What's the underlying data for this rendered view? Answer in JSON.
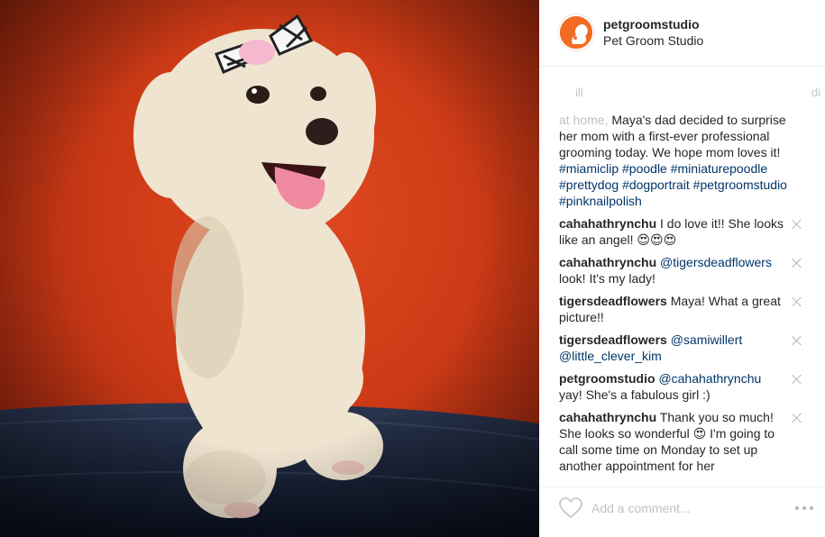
{
  "post": {
    "image_alt": "Poodle with bow on red background",
    "colors": {
      "background": "#cc3a16",
      "fur": "#f1e6d3",
      "tongue": "#f08aa0",
      "seat": "#141d30"
    }
  },
  "header": {
    "username": "petgroomstudio",
    "display_name": "Pet Groom Studio",
    "avatar_icon": "squirrel-logo-icon"
  },
  "faded_row": {
    "left": "ill",
    "right": "di"
  },
  "caption": {
    "faded_start": "at home,",
    "text_1": " Maya's dad decided to surprise her mom with a first-ever professional grooming today. We hope mom loves it! ",
    "hashtags": [
      "#miamiclip",
      "#poodle",
      "#miniaturepoodle",
      "#prettydog",
      "#dogportrait",
      "#petgroomstudio",
      "#pinknailpolish"
    ]
  },
  "comments": [
    {
      "author": "cahahathrynchu",
      "mention": "",
      "text": "I do love it!! She looks like an angel! 😍😍😍"
    },
    {
      "author": "cahahathrynchu",
      "mention": "@tigersdeadflowers",
      "text": " look! It's my lady!"
    },
    {
      "author": "tigersdeadflowers",
      "mention": "",
      "text": "Maya! What a great picture!!"
    },
    {
      "author": "tigersdeadflowers",
      "mention": "@samiwillert @little_clever_kim",
      "text": ""
    },
    {
      "author": "petgroomstudio",
      "mention": "@cahahathrynchu",
      "text": " yay! She's a fabulous girl :)"
    },
    {
      "author": "cahahathrynchu",
      "mention": "",
      "text": "Thank you so much! She looks so wonderful 😍 I'm going to call some time on Monday to set up another appointment for her"
    }
  ],
  "footer": {
    "like_icon": "heart-icon",
    "comment_placeholder": "Add a comment...",
    "more_icon": "more-options-icon"
  }
}
